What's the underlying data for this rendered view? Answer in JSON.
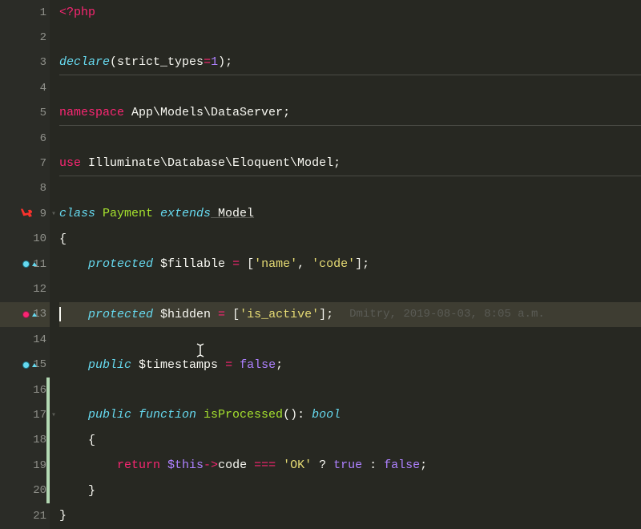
{
  "lines": [
    {
      "num": "1"
    },
    {
      "num": "2"
    },
    {
      "num": "3"
    },
    {
      "num": "4"
    },
    {
      "num": "5"
    },
    {
      "num": "6"
    },
    {
      "num": "7"
    },
    {
      "num": "8"
    },
    {
      "num": "9"
    },
    {
      "num": "10"
    },
    {
      "num": "11"
    },
    {
      "num": "12"
    },
    {
      "num": "13"
    },
    {
      "num": "14"
    },
    {
      "num": "15"
    },
    {
      "num": "16"
    },
    {
      "num": "17"
    },
    {
      "num": "18"
    },
    {
      "num": "19"
    },
    {
      "num": "20"
    },
    {
      "num": "21"
    }
  ],
  "code": {
    "l1_open": "<?php",
    "l3_declare": "declare",
    "l3_open": "(",
    "l3_strict": "strict_types",
    "l3_eq": "=",
    "l3_one": "1",
    "l3_close": ");",
    "l5_ns": "namespace",
    "l5_path": " App\\Models\\DataServer",
    "l5_semi": ";",
    "l7_use": "use",
    "l7_path": " Illuminate\\Database\\Eloquent\\Model",
    "l7_semi": ";",
    "l9_class": "class",
    "l9_name": " Payment ",
    "l9_extends": "extends",
    "l9_base": " Model",
    "l10_brace": "{",
    "l11_protected": "protected",
    "l11_var": " $fillable ",
    "l11_eq": "= ",
    "l11_br1": "[",
    "l11_s1": "'name'",
    "l11_c": ", ",
    "l11_s2": "'code'",
    "l11_br2": "];",
    "l13_protected": "protected",
    "l13_var": " $hidden ",
    "l13_eq": "= ",
    "l13_br1": "[",
    "l13_s1": "'is_active'",
    "l13_br2": "];",
    "l13_blame": "Dmitry, 2019-08-03, 8:05 a.m.",
    "l15_public": "public",
    "l15_var": " $timestamps ",
    "l15_eq": "= ",
    "l15_val": "false",
    "l15_semi": ";",
    "l17_public": "public",
    "l17_func": " function ",
    "l17_name": "isProcessed",
    "l17_parens": "(): ",
    "l17_type": "bool",
    "l18_brace": "{",
    "l19_return": "return",
    "l19_this": " $this",
    "l19_arrow": "->",
    "l19_code": "code ",
    "l19_eqeqeq": "=== ",
    "l19_ok": "'OK'",
    "l19_q": " ? ",
    "l19_true": "true",
    "l19_colon": " : ",
    "l19_false": "false",
    "l19_semi": ";",
    "l20_brace": "}",
    "l21_brace": "}"
  }
}
